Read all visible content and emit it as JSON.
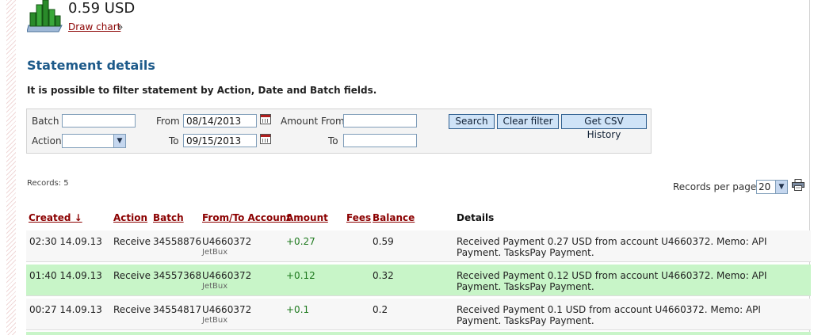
{
  "header": {
    "balance": "0.59 USD",
    "draw_chart": "Draw chart",
    "draw_chart_arrow": "»"
  },
  "section": {
    "title": "Statement details",
    "filter_hint": "It is possible to filter statement by Action, Date and Batch fields."
  },
  "filter": {
    "batch_label": "Batch",
    "batch_value": "",
    "action_label": "Action",
    "action_value": "",
    "from_label": "From",
    "from_value": "08/14/2013",
    "to_label": "To",
    "to_value": "09/15/2013",
    "amount_from_label": "Amount From",
    "amount_from_value": "",
    "amount_to_label": "To",
    "amount_to_value": "",
    "search_button": "Search",
    "clear_button": "Clear filter",
    "csv_button": "Get CSV History"
  },
  "records": {
    "count_label": "Records: 5",
    "per_page_label": "Records per page:",
    "per_page_value": "20"
  },
  "table": {
    "headers": {
      "created": "Created ↓",
      "action": "Action",
      "batch": "Batch",
      "account": "From/To Account",
      "amount": "Amount",
      "fees": "Fees",
      "balance": "Balance",
      "details": "Details"
    },
    "rows": [
      {
        "created": "02:30 14.09.13",
        "action": "Receive",
        "batch": "34558876",
        "account": "U4660372",
        "account_name": "JetBux",
        "amount": "+0.27",
        "fees": "",
        "balance": "0.59",
        "details": "Received Payment 0.27 USD from account U4660372. Memo: API Payment. TasksPay Payment."
      },
      {
        "created": "01:40 14.09.13",
        "action": "Receive",
        "batch": "34557368",
        "account": "U4660372",
        "account_name": "JetBux",
        "amount": "+0.12",
        "fees": "",
        "balance": "0.32",
        "details": "Received Payment 0.12 USD from account U4660372. Memo: API Payment. TasksPay Payment."
      },
      {
        "created": "00:27 14.09.13",
        "action": "Receive",
        "batch": "34554817",
        "account": "U4660372",
        "account_name": "JetBux",
        "amount": "+0.1",
        "fees": "",
        "balance": "0.2",
        "details": "Received Payment 0.1 USD from account U4660372. Memo: API Payment. TasksPay Payment."
      }
    ]
  },
  "icons": {
    "chart": "bar-chart-icon",
    "calendar": "calendar-icon",
    "print": "printer-icon",
    "dropdown": "chevron-down-icon"
  },
  "colors": {
    "link": "#8b0000",
    "title": "#1d5a8a",
    "row_green": "#c8f5c8",
    "amount_positive": "#1f7a1f",
    "button_bg": "#cfe3f7"
  }
}
